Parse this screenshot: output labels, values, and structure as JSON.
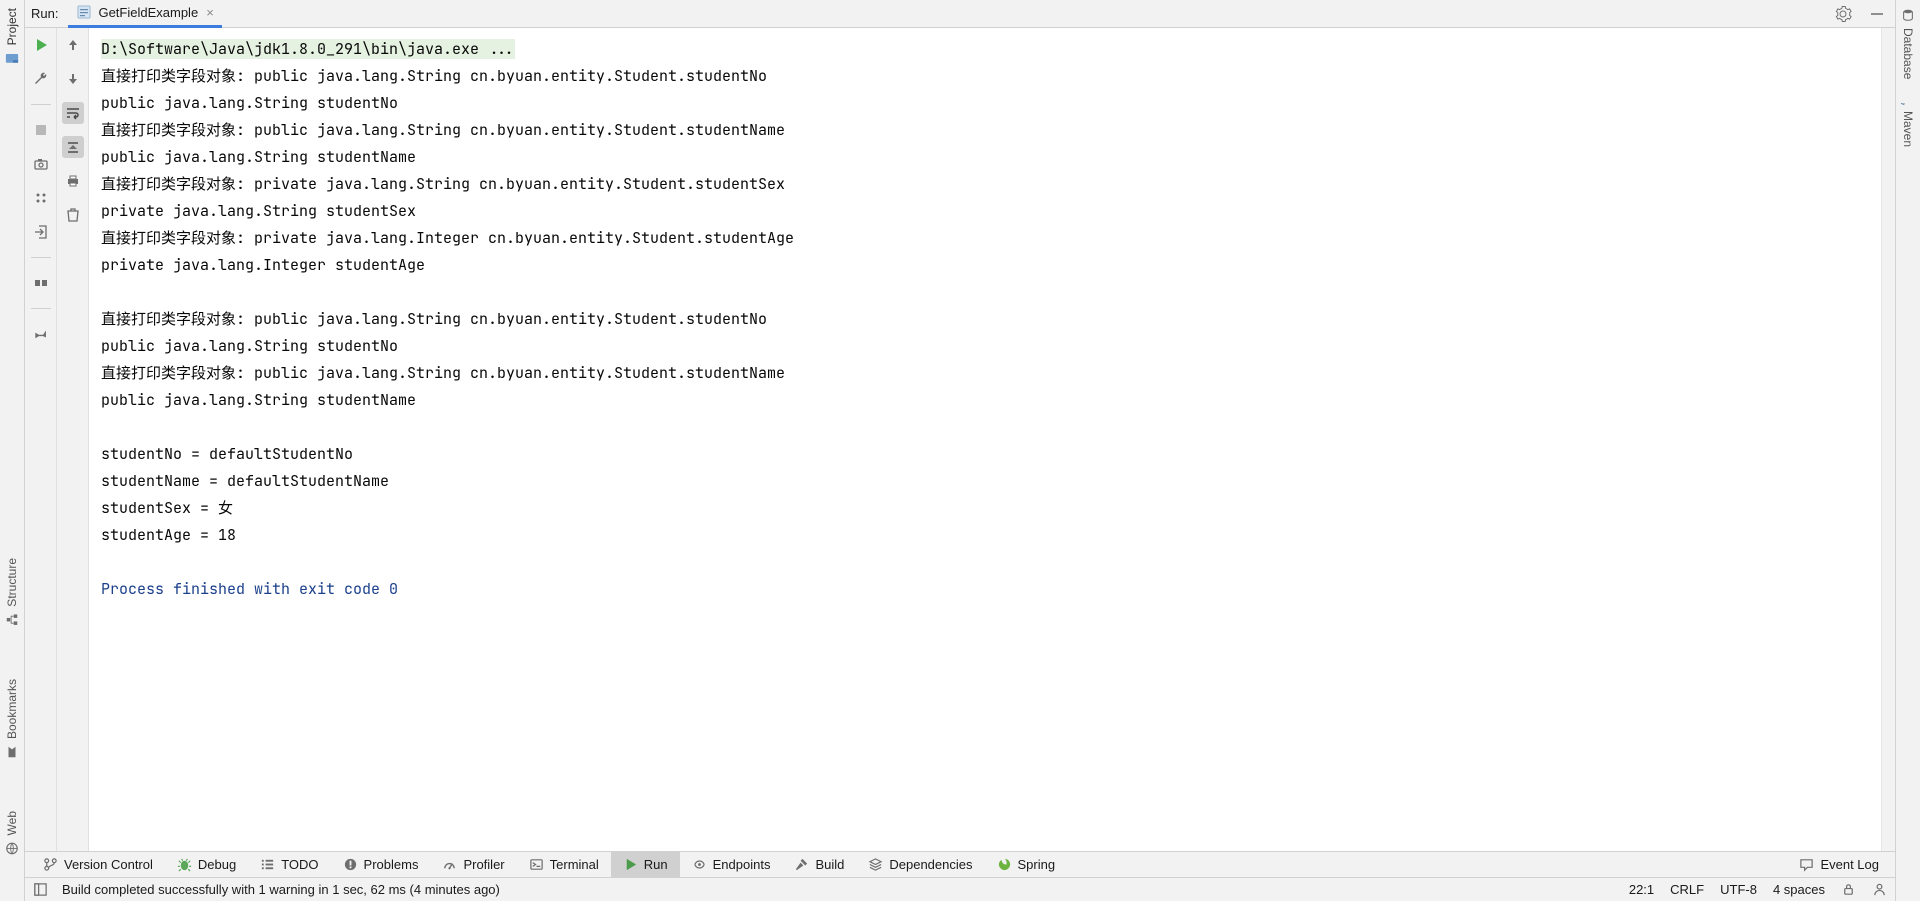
{
  "left_sidebar": {
    "project": "Project",
    "structure": "Structure",
    "bookmarks": "Bookmarks",
    "web": "Web"
  },
  "right_sidebar": {
    "database": "Database",
    "maven": "Maven"
  },
  "run_header": {
    "label": "Run:",
    "tab_name": "GetFieldExample",
    "close_glyph": "×"
  },
  "console": {
    "cmd": "D:\\Software\\Java\\jdk1.8.0_291\\bin\\java.exe ...",
    "lines": [
      "直接打印类字段对象: public java.lang.String cn.byuan.entity.Student.studentNo",
      "public java.lang.String studentNo",
      "直接打印类字段对象: public java.lang.String cn.byuan.entity.Student.studentName",
      "public java.lang.String studentName",
      "直接打印类字段对象: private java.lang.String cn.byuan.entity.Student.studentSex",
      "private java.lang.String studentSex",
      "直接打印类字段对象: private java.lang.Integer cn.byuan.entity.Student.studentAge",
      "private java.lang.Integer studentAge",
      "",
      "直接打印类字段对象: public java.lang.String cn.byuan.entity.Student.studentNo",
      "public java.lang.String studentNo",
      "直接打印类字段对象: public java.lang.String cn.byuan.entity.Student.studentName",
      "public java.lang.String studentName",
      "",
      "studentNo = defaultStudentNo",
      "studentName = defaultStudentName",
      "studentSex = 女",
      "studentAge = 18",
      ""
    ],
    "exit": "Process finished with exit code 0"
  },
  "bottom_tabs": {
    "version_control": "Version Control",
    "debug": "Debug",
    "todo": "TODO",
    "problems": "Problems",
    "profiler": "Profiler",
    "terminal": "Terminal",
    "run": "Run",
    "endpoints": "Endpoints",
    "build": "Build",
    "dependencies": "Dependencies",
    "spring": "Spring",
    "event_log": "Event Log"
  },
  "status_bar": {
    "message": "Build completed successfully with 1 warning in 1 sec, 62 ms (4 minutes ago)",
    "caret": "22:1",
    "line_sep": "CRLF",
    "encoding": "UTF-8",
    "indent": "4 spaces"
  }
}
